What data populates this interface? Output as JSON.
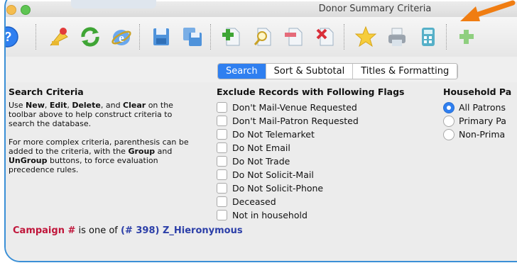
{
  "window": {
    "title": "Donor Summary Criteria"
  },
  "toolbar": {
    "buttons": [
      {
        "icon": "help-icon",
        "name": "help"
      },
      {
        "icon": "pin-icon",
        "name": "new"
      },
      {
        "icon": "refresh-icon",
        "name": "edit"
      },
      {
        "icon": "internet-icon",
        "name": "web"
      },
      {
        "icon": "save-icon",
        "name": "save"
      },
      {
        "icon": "save-as-icon",
        "name": "save-as"
      },
      {
        "icon": "add-icon",
        "name": "add"
      },
      {
        "icon": "search-icon",
        "name": "find"
      },
      {
        "icon": "remove-icon",
        "name": "remove"
      },
      {
        "icon": "delete-icon",
        "name": "clear"
      },
      {
        "icon": "star-icon",
        "name": "favorite"
      },
      {
        "icon": "print-icon",
        "name": "print"
      },
      {
        "icon": "calculator-icon",
        "name": "calculate"
      },
      {
        "icon": "group-icon",
        "name": "group"
      }
    ]
  },
  "tabs": [
    {
      "label": "Search",
      "active": true
    },
    {
      "label": "Sort & Subtotal",
      "active": false
    },
    {
      "label": "Titles & Formatting",
      "active": false
    }
  ],
  "search_criteria": {
    "title": "Search Criteria",
    "para1": [
      {
        "text": "Use ",
        "bold": false
      },
      {
        "text": "New",
        "bold": true
      },
      {
        "text": ", ",
        "bold": false
      },
      {
        "text": "Edit",
        "bold": true
      },
      {
        "text": ", ",
        "bold": false
      },
      {
        "text": "Delete",
        "bold": true
      },
      {
        "text": ", and ",
        "bold": false
      },
      {
        "text": "Clear",
        "bold": true
      },
      {
        "text": " on the toolbar above to help construct criteria to search the database.",
        "bold": false
      }
    ],
    "para2": [
      {
        "text": "For more complex criteria, parenthesis can be added to the criteria, with the ",
        "bold": false
      },
      {
        "text": "Group",
        "bold": true
      },
      {
        "text": " and ",
        "bold": false
      },
      {
        "text": "UnGroup",
        "bold": true
      },
      {
        "text": " buttons, to force evaluation precedence rules.",
        "bold": false
      }
    ]
  },
  "exclude_flags": {
    "title": "Exclude Records with Following Flags",
    "items": [
      "Don't Mail-Venue Requested",
      "Don't Mail-Patron Requested",
      "Do Not Telemarket",
      "Do Not Email",
      "Do Not Trade",
      "Do Not Solicit-Mail",
      "Do Not Solicit-Phone",
      "Deceased",
      "Not in household"
    ]
  },
  "household": {
    "title": "Household Pa",
    "options": [
      {
        "label": "All Patrons",
        "selected": true
      },
      {
        "label": "Primary Pa",
        "selected": false
      },
      {
        "label": "Non-Prima",
        "selected": false
      }
    ]
  },
  "criteria_line": {
    "field": "Campaign #",
    "operator": " is one of ",
    "value": "(# 398) Z_Hieronymous"
  },
  "colors": {
    "accent": "#2f7ff0",
    "frame": "#3a8fd6",
    "arrow": "#f07d12",
    "field": "#c0163b",
    "value": "#2c3fa8"
  }
}
